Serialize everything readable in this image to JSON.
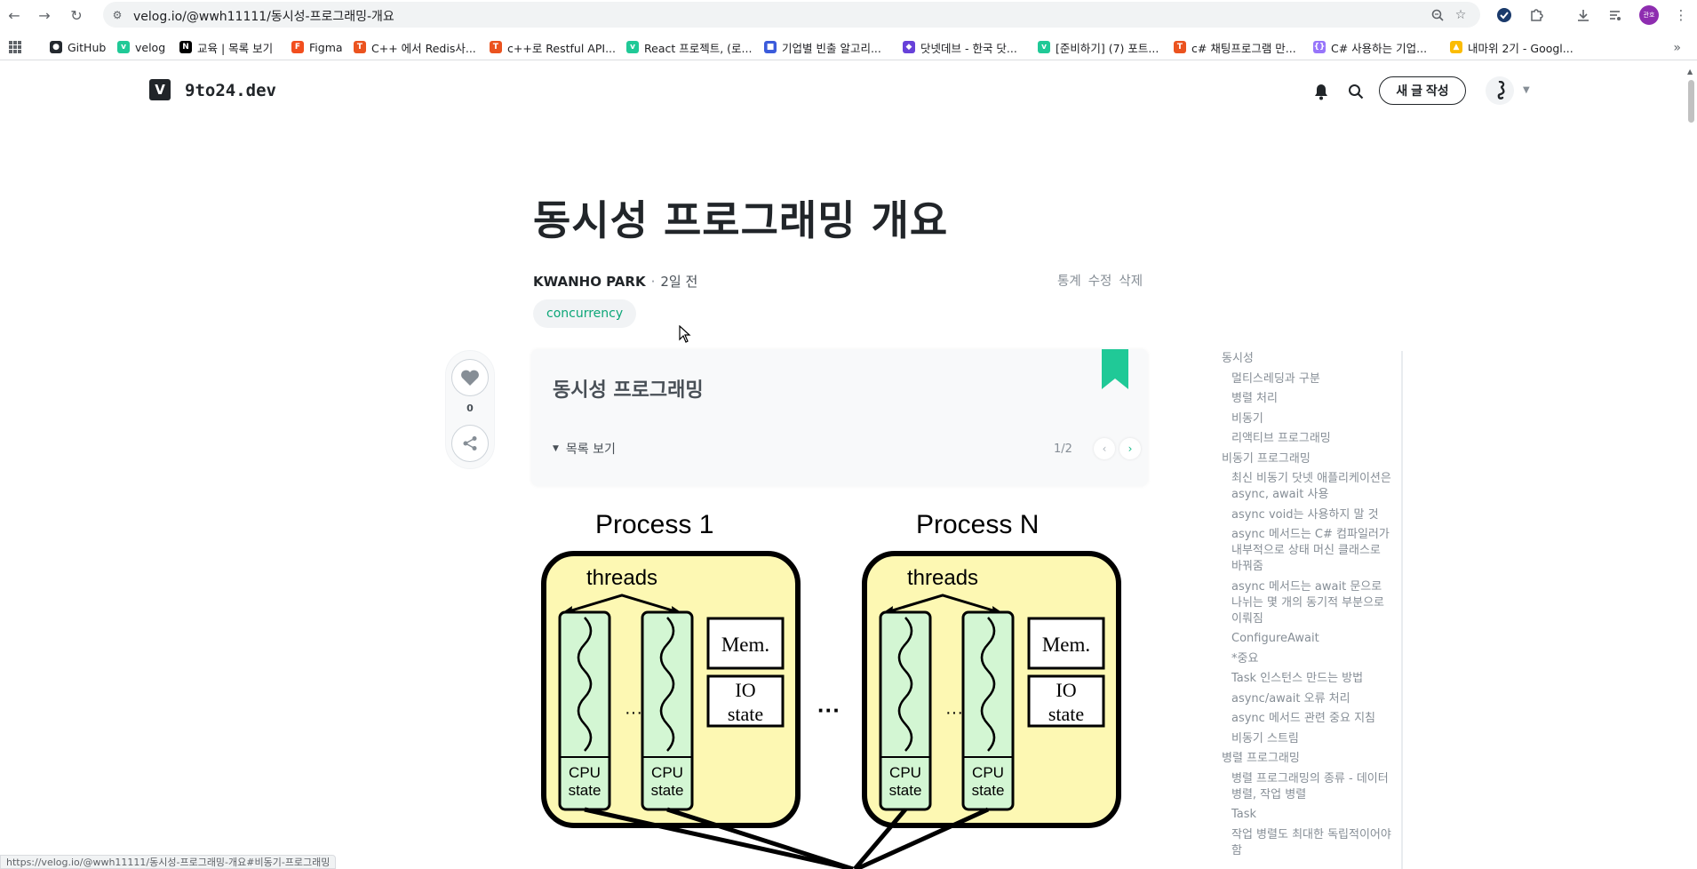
{
  "browser": {
    "url": "velog.io/@wwh11111/동시성-프로그래밍-개요",
    "status_url": "https://velog.io/@wwh11111/동시성-프로그래밍-개요#비동기-프로그래밍",
    "profile_label": "관호",
    "bookmarks": [
      {
        "label": "GitHub",
        "icon": "github-icon",
        "color": "#24292f"
      },
      {
        "label": "velog",
        "icon": "velog-icon",
        "color": "#20c997"
      },
      {
        "label": "교육 | 목록 보기",
        "icon": "notion-icon",
        "color": "#000000"
      },
      {
        "label": "Figma",
        "icon": "figma-icon",
        "color": "#f24e1e"
      },
      {
        "label": "C++ 에서 Redis사...",
        "icon": "tistory-icon",
        "color": "#eb531f"
      },
      {
        "label": "c++로 Restful API...",
        "icon": "tistory-icon",
        "color": "#eb531f"
      },
      {
        "label": "React 프로젝트, (로...",
        "icon": "velog-icon",
        "color": "#20c997"
      },
      {
        "label": "기업별 빈출 알고리...",
        "icon": "bookmark-site-icon",
        "color": "#3b5bdb"
      },
      {
        "label": "닷넷데브 - 한국 닷...",
        "icon": "dotnetdev-icon",
        "color": "#6741d9"
      },
      {
        "label": "[준비하기] (7) 포트...",
        "icon": "velog-icon",
        "color": "#20c997"
      },
      {
        "label": "c# 채팅프로그램 만...",
        "icon": "tistory-icon",
        "color": "#eb531f"
      },
      {
        "label": "C# 사용하는 기업...",
        "icon": "bracket-icon",
        "color": "#9775fa"
      },
      {
        "label": "내마위 2기 - Googl...",
        "icon": "google-drive-icon",
        "color": "#fbbc04"
      }
    ]
  },
  "header": {
    "logo_letter": "V",
    "blog_name": "9to24.dev",
    "write_button": "새 글 작성"
  },
  "post": {
    "title": "동시성 프로그래밍 개요",
    "author": "KWANHO PARK",
    "separator": "·",
    "date": "2일 전",
    "actions": [
      "통계",
      "수정",
      "삭제"
    ],
    "tag": "concurrency",
    "like_count": "0"
  },
  "series": {
    "title": "동시성 프로그래밍",
    "toggle_label": "목록 보기",
    "page": "1/2"
  },
  "diagram": {
    "process_left": "Process 1",
    "process_right": "Process N",
    "threads_label": "threads",
    "mem_label": "Mem.",
    "io_label_1": "IO",
    "io_label_2": "state",
    "cpu_label_1": "CPU",
    "cpu_label_2": "state",
    "ellipsis": "···",
    "colors": {
      "process_fill": "#fdf8b3",
      "thread_fill": "#d3f6d3",
      "stroke": "#000000"
    }
  },
  "toc": [
    {
      "level": 1,
      "text": "동시성"
    },
    {
      "level": 2,
      "text": "멀티스레딩과 구분"
    },
    {
      "level": 2,
      "text": "병렬 처리"
    },
    {
      "level": 2,
      "text": "비동기"
    },
    {
      "level": 2,
      "text": "리액티브 프로그래밍"
    },
    {
      "level": 1,
      "text": "비동기 프로그래밍"
    },
    {
      "level": 2,
      "text": "최신 비동기 닷넷 애플리케이션은 async, await 사용"
    },
    {
      "level": 2,
      "text": "async void는 사용하지 말 것"
    },
    {
      "level": 2,
      "text": "async 메서드는 C# 컴파일러가 내부적으로 상태 머신 클래스로 바꿔줌"
    },
    {
      "level": 2,
      "text": "async 메서드는 await 문으로 나뉘는 몇 개의 동기적 부분으로 이뤄짐"
    },
    {
      "level": 2,
      "text": "ConfigureAwait"
    },
    {
      "level": 2,
      "text": "*중요"
    },
    {
      "level": 2,
      "text": "Task 인스턴스 만드는 방법"
    },
    {
      "level": 2,
      "text": "async/await 오류 처리"
    },
    {
      "level": 2,
      "text": "async 메서드 관련 중요 지침"
    },
    {
      "level": 2,
      "text": "비동기 스트림"
    },
    {
      "level": 1,
      "text": "병렬 프로그래밍"
    },
    {
      "level": 2,
      "text": "병렬 프로그래밍의 종류 - 데이터 병렬, 작업 병렬"
    },
    {
      "level": 2,
      "text": "Task"
    },
    {
      "level": 2,
      "text": "작업 병렬도 최대한 독립적이어야 함"
    }
  ]
}
